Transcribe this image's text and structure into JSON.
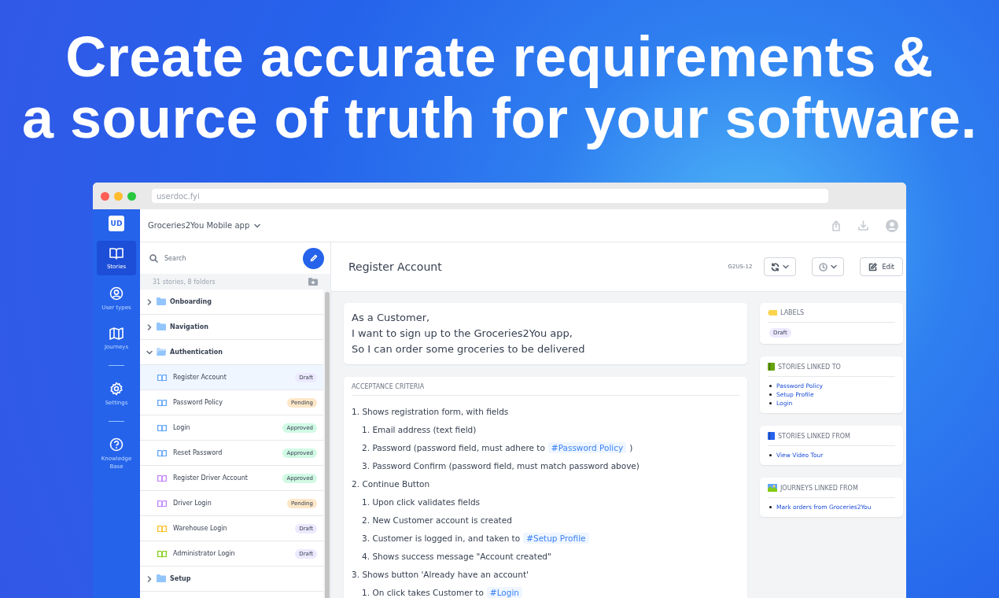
{
  "headline": [
    "Create accurate requirements &",
    "a source of truth for your software."
  ],
  "browser": {
    "url": "userdoc.fyi"
  },
  "rail": {
    "logo": "UD",
    "items": [
      {
        "label": "Stories",
        "kind": "book",
        "selected": true
      },
      {
        "label": "User types",
        "kind": "user",
        "selected": false
      },
      {
        "label": "Journeys",
        "kind": "map",
        "selected": false
      },
      {
        "label": "Settings",
        "kind": "gear",
        "selected": false
      },
      {
        "label": "Knowledge Base",
        "kind": "help",
        "selected": false
      }
    ]
  },
  "project": {
    "name": "Groceries2You Mobile app"
  },
  "stories": {
    "placeholder": "Search",
    "count": "31 stories, 8 folders",
    "tree": [
      {
        "label": "Onboarding",
        "expanded": false
      },
      {
        "label": "Navigation",
        "expanded": false
      },
      {
        "label": "Authentication",
        "expanded": true,
        "children": [
          {
            "label": "Register Account",
            "color": "#60a5fa",
            "status": "Draft",
            "kind": "draft",
            "selected": true
          },
          {
            "label": "Password Policy",
            "color": "#60a5fa",
            "status": "Pending",
            "kind": "pending",
            "selected": false
          },
          {
            "label": "Login",
            "color": "#60a5fa",
            "status": "Approved",
            "kind": "approved",
            "selected": false
          },
          {
            "label": "Reset Password",
            "color": "#60a5fa",
            "status": "Approved",
            "kind": "approved",
            "selected": false
          },
          {
            "label": "Register Driver Account",
            "color": "#c084fc",
            "status": "Approved",
            "kind": "approved",
            "selected": false
          },
          {
            "label": "Driver Login",
            "color": "#c084fc",
            "status": "Pending",
            "kind": "pending",
            "selected": false
          },
          {
            "label": "Warehouse Login",
            "color": "#fbbf24",
            "status": "Draft",
            "kind": "draft",
            "selected": false
          },
          {
            "label": "Administrator Login",
            "color": "#84cc16",
            "status": "Draft",
            "kind": "draft",
            "selected": false
          }
        ]
      },
      {
        "label": "Setup",
        "expanded": false
      }
    ]
  },
  "detail": {
    "title": "Register Account",
    "id": "G2US-12",
    "edit": "Edit",
    "story": [
      "As a Customer,",
      "I want to sign up to the Groceries2You app,",
      "So I can order some groceries to be delivered"
    ],
    "criteria_title": "ACCEPTANCE CRITERIA",
    "criteria": [
      {
        "number": "1.",
        "text": "Shows registration form, with fields",
        "children": [
          {
            "number": "1.",
            "text": "Email address (text field)"
          },
          {
            "number": "2.",
            "text": "Password (password field, must adhere to",
            "link": "#Password Policy",
            "after": ")"
          },
          {
            "number": "3.",
            "text": "Password Confirm (password field, must match password above)"
          }
        ]
      },
      {
        "number": "2.",
        "text": "Continue Button",
        "children": [
          {
            "number": "1.",
            "text": "Upon click validates fields"
          },
          {
            "number": "2.",
            "text": "New Customer account is created"
          },
          {
            "number": "3.",
            "text": "Customer is logged in, and taken to",
            "link": "#Setup Profile"
          },
          {
            "number": "4.",
            "text": "Shows success message \"Account created\""
          }
        ]
      },
      {
        "number": "3.",
        "text": "Shows button 'Already have an account'",
        "children": [
          {
            "number": "1.",
            "text": "On click takes Customer to",
            "link": "#Login"
          }
        ]
      }
    ]
  },
  "panels": [
    {
      "title": "LABELS",
      "kind": "tag",
      "labels": [
        "Draft"
      ]
    },
    {
      "title": "STORIES LINKED TO",
      "kind": "green-book",
      "links": [
        "Password Policy",
        "Setup Profile",
        "Login"
      ]
    },
    {
      "title": "STORIES LINKED FROM",
      "kind": "blue-book",
      "links": [
        "View Video Tour"
      ]
    },
    {
      "title": "JOURNEYS LINKED FROM",
      "kind": "map-picture",
      "links": [
        "Mark orders from Groceries2You"
      ]
    }
  ]
}
